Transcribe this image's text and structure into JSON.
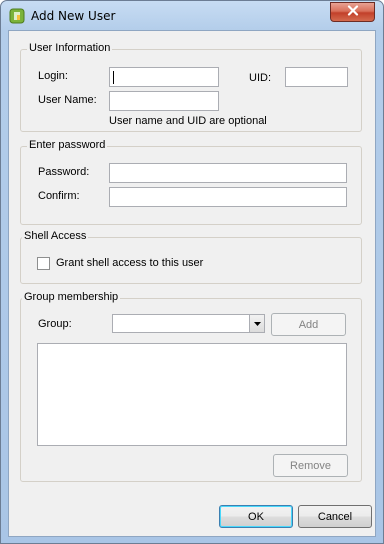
{
  "window": {
    "title": "Add New User",
    "close_icon": "close-icon",
    "app_icon": "app-icon"
  },
  "user_info": {
    "legend": "User Information",
    "login_label": "Login:",
    "login_value": "",
    "uid_label": "UID:",
    "uid_value": "",
    "username_label": "User Name:",
    "username_value": "",
    "hint": "User name and UID are optional"
  },
  "password": {
    "legend": "Enter password",
    "password_label": "Password:",
    "password_value": "",
    "confirm_label": "Confirm:",
    "confirm_value": ""
  },
  "shell": {
    "legend": "Shell Access",
    "checkbox_label": "Grant shell access to this user",
    "checked": false
  },
  "group": {
    "legend": "Group membership",
    "group_label": "Group:",
    "group_selected": "",
    "add_label": "Add",
    "remove_label": "Remove",
    "members": []
  },
  "footer": {
    "ok_label": "OK",
    "cancel_label": "Cancel"
  },
  "colors": {
    "close_button": "#c2402a",
    "title_bar": "#b3cdea",
    "client_background": "#f0f0f0"
  }
}
